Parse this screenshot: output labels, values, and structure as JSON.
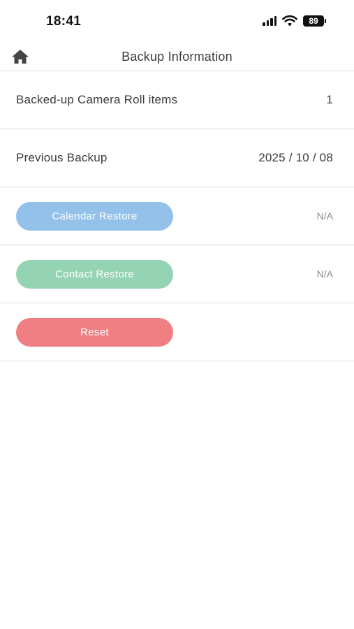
{
  "status_bar": {
    "time": "18:41",
    "battery_level": "89",
    "icons": [
      "signal-icon",
      "wifi-icon",
      "battery-icon"
    ]
  },
  "nav": {
    "title": "Backup Information",
    "home_icon": "home-icon"
  },
  "rows": {
    "camera_roll": {
      "label": "Backed-up Camera Roll items",
      "value": "1"
    },
    "previous_backup": {
      "label": "Previous Backup",
      "value": "2025 / 10 / 08"
    },
    "calendar_restore": {
      "button_label": "Calendar Restore",
      "status": "N/A"
    },
    "contact_restore": {
      "button_label": "Contact Restore",
      "status": "N/A"
    },
    "reset": {
      "button_label": "Reset"
    }
  },
  "colors": {
    "calendar_button": "#93c1ea",
    "contact_button": "#94d3b3",
    "reset_button": "#ef7f83",
    "divider": "#dcdcdc"
  }
}
